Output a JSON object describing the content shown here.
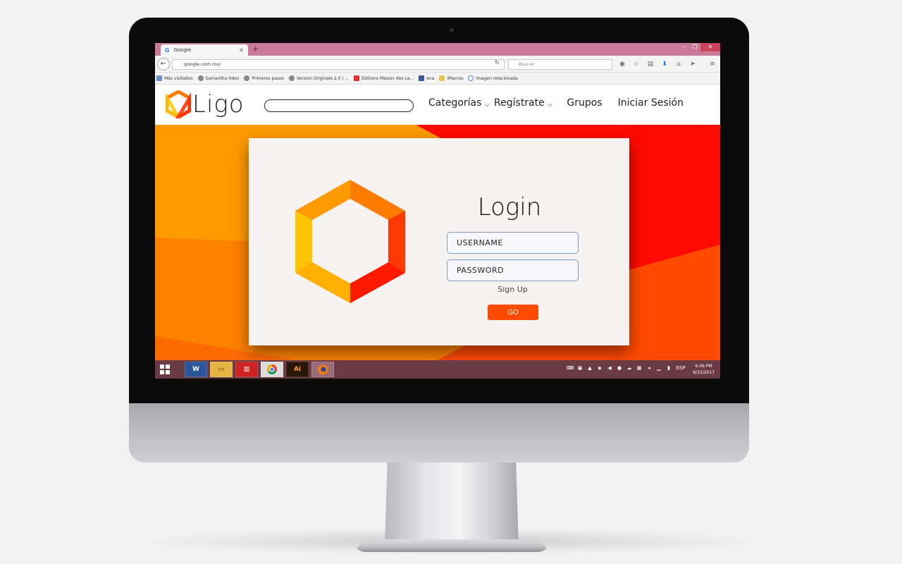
{
  "browser": {
    "tab_title": "Google",
    "tab_favicon": "G",
    "url": "google.com.mx/",
    "search_placeholder": "Buscar",
    "bookmarks": [
      {
        "label": "Más visitados",
        "icon": "square"
      },
      {
        "label": "Samantha Hdez",
        "icon": "globe"
      },
      {
        "label": "Primeros pasos",
        "icon": "globe"
      },
      {
        "label": "Version Originale 2.0 | ...",
        "icon": "globe"
      },
      {
        "label": "Editions Maison des La...",
        "icon": "red"
      },
      {
        "label": "ena",
        "icon": "facebook"
      },
      {
        "label": "iMacros",
        "icon": "folder"
      },
      {
        "label": "Imagen relacionada",
        "icon": "google"
      }
    ]
  },
  "site": {
    "brand": "Ligo",
    "nav": {
      "categorias": "Categorías",
      "registrate": "Regístrate",
      "grupos": "Grupos",
      "iniciar_sesion": "Iniciar Sesión"
    },
    "login": {
      "title": "Login",
      "username_placeholder": "USERNAME",
      "password_placeholder": "PASSWORD",
      "signup": "Sign Up",
      "go": "GO"
    }
  },
  "taskbar": {
    "apps": [
      "word",
      "file-explorer",
      "popcorn",
      "chrome",
      "illustrator",
      "firefox"
    ],
    "word_label": "W",
    "ai_label": "Ai",
    "lang": "ESP",
    "time": "6:06 PM",
    "date": "8/22/2017"
  },
  "colors": {
    "accent": "#ff4a00",
    "hero_orange": "#f77e0a",
    "hero_red": "#ff1a00",
    "tabbar": "#c97a96",
    "taskbar": "#6a3a45"
  }
}
